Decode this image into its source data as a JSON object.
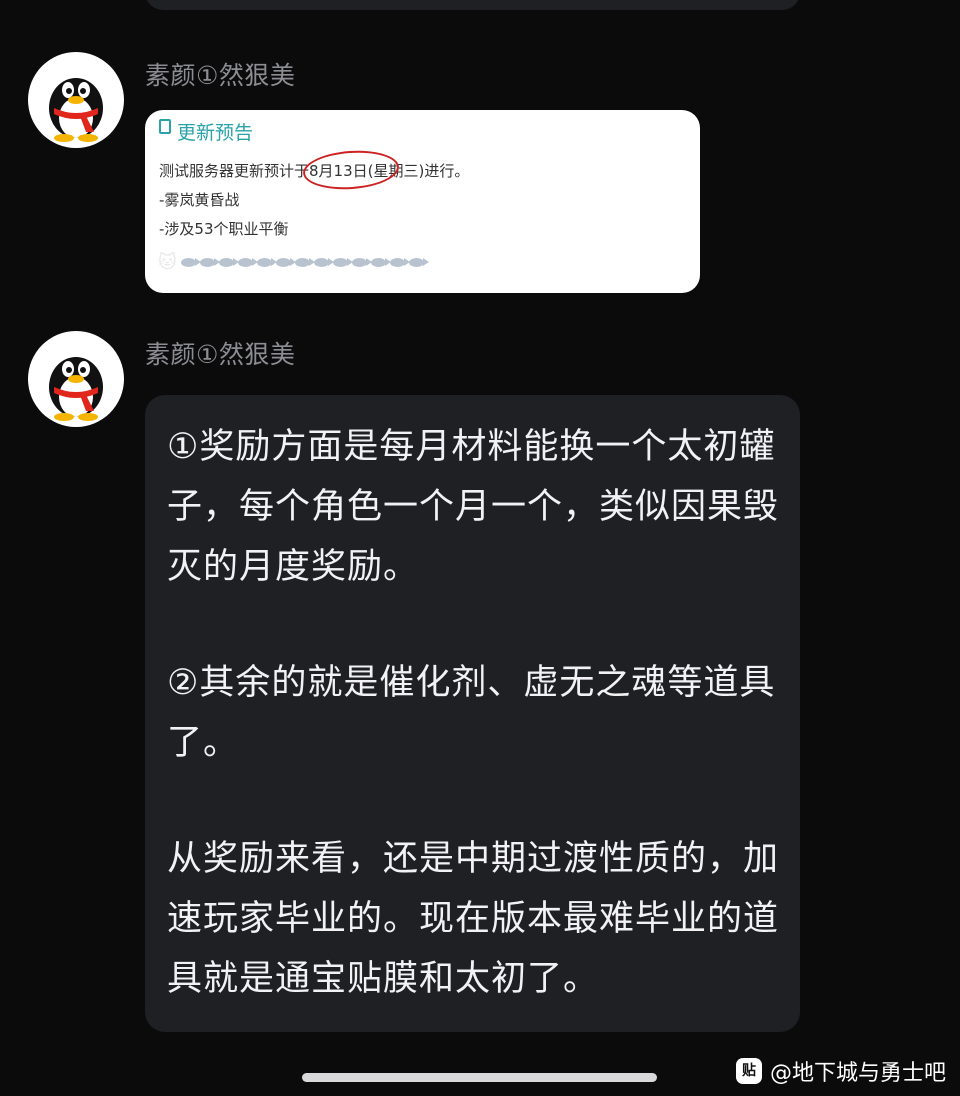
{
  "message1": {
    "sender": "素颜①然狠美",
    "card": {
      "title": "更新预告",
      "line1": "测试服务器更新预计于8月13日(星期三)进行。",
      "line2": "-雾岚黄昏战",
      "line3": "-涉及53个职业平衡"
    }
  },
  "message2": {
    "sender": "素颜①然狠美",
    "paragraphs": [
      "①奖励方面是每月材料能换一个太初罐子，每个角色一个月一个，类似因果毁灭的月度奖励。",
      "②其余的就是催化剂、虚无之魂等道具了。",
      "从奖励来看，还是中期过渡性质的，加速玩家毕业的。现在版本最难毕业的道具就是通宝贴膜和太初了。"
    ]
  },
  "watermark": {
    "logo": "贴",
    "text": "@地下城与勇士吧"
  },
  "colors": {
    "background": "#0b0b0c",
    "bubble": "#1f2023",
    "sender": "#8d8e93",
    "card_title": "#2aa3a8",
    "highlight_circle": "#cc2222"
  }
}
